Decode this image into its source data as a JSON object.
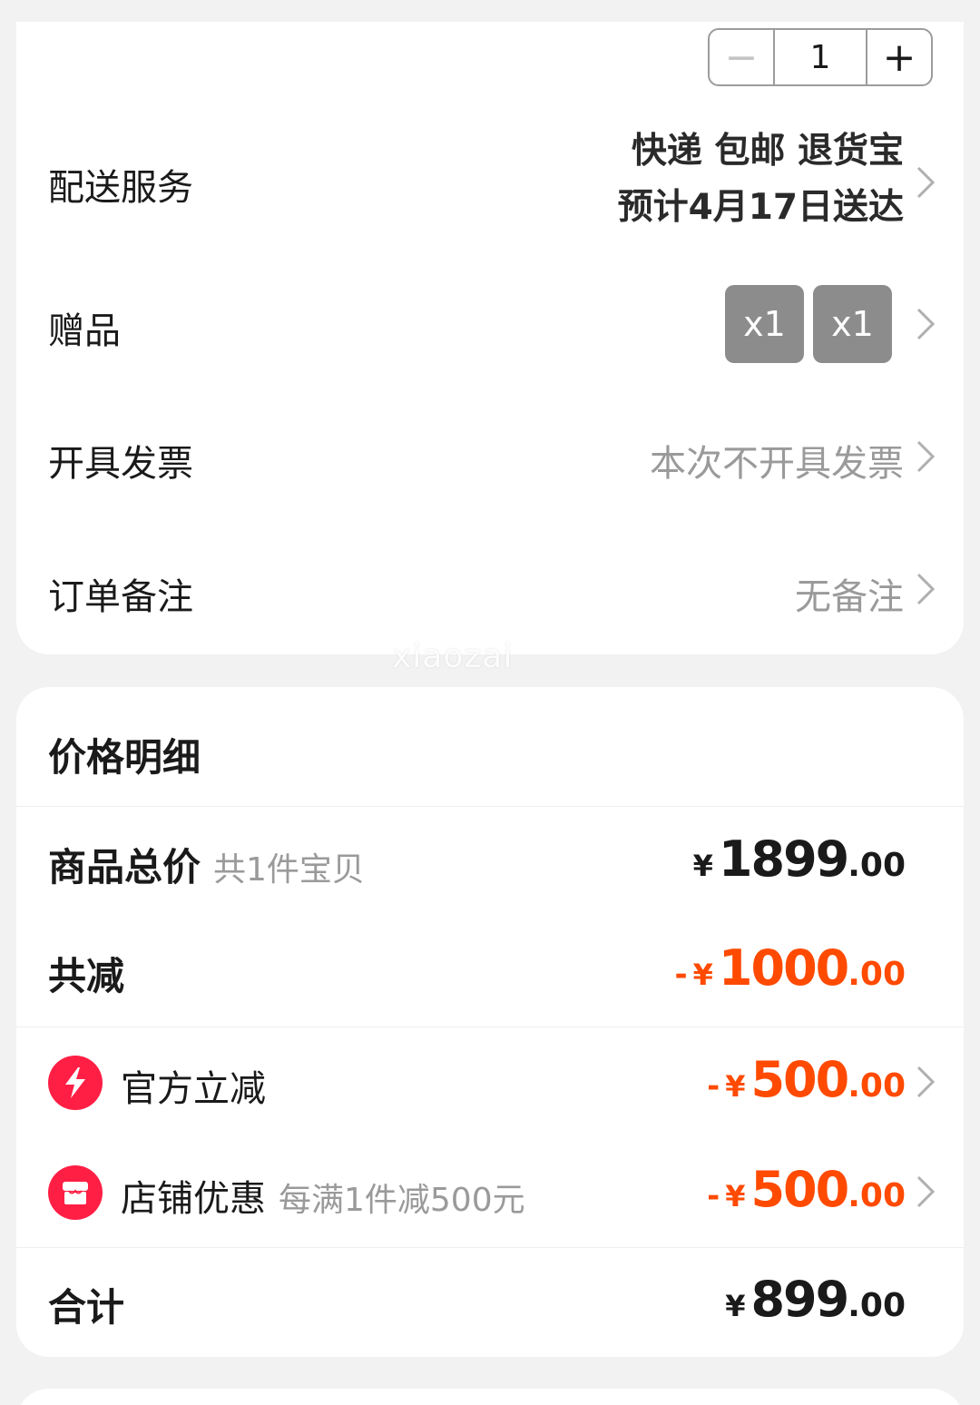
{
  "quantity": {
    "minus_symbol": "−",
    "value": "1",
    "plus_symbol": "+"
  },
  "delivery": {
    "label": "配送服务",
    "value_line1": "快递 包邮 退货宝",
    "value_line2": "预计4月17日送达"
  },
  "gift": {
    "label": "赠品",
    "items": [
      {
        "qty_label": "x1"
      },
      {
        "qty_label": "x1"
      }
    ]
  },
  "invoice": {
    "label": "开具发票",
    "value": "本次不开具发票"
  },
  "remark": {
    "label": "订单备注",
    "value": "无备注"
  },
  "watermark": "xiaozai",
  "price_detail": {
    "title": "价格明细",
    "subtotal": {
      "label": "商品总价",
      "sub": "共1件宝贝",
      "yen": "¥",
      "integer": "1899",
      "decimal": ".00"
    },
    "total_reduction": {
      "label": "共减",
      "sign": "-",
      "yen": "¥",
      "integer": "1000",
      "decimal": ".00"
    },
    "discounts": [
      {
        "icon": "lightning-icon",
        "label": "官方立减",
        "sub": "",
        "sign": "-",
        "yen": "¥",
        "integer": "500",
        "decimal": ".00"
      },
      {
        "icon": "store-icon",
        "label": "店铺优惠",
        "sub": "每满1件减500元",
        "sign": "-",
        "yen": "¥",
        "integer": "500",
        "decimal": ".00"
      }
    ],
    "total": {
      "label": "合计",
      "yen": "¥",
      "integer": "899",
      "decimal": ".00"
    }
  },
  "colors": {
    "accent_orange": "#ff4a00",
    "icon_red": "#ff1f45",
    "muted_text": "#9a9a9a",
    "background": "#f2f2f2"
  }
}
